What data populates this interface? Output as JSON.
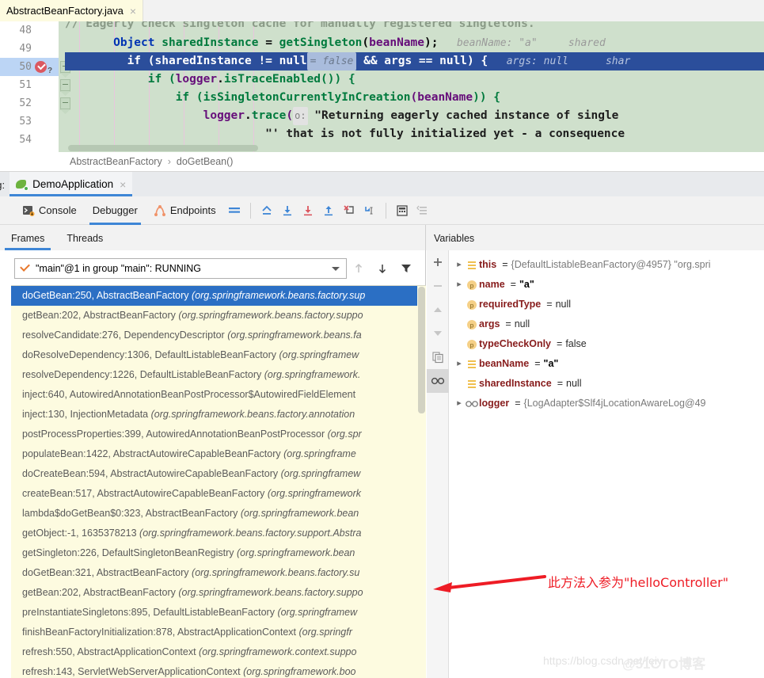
{
  "editor": {
    "tab": {
      "filename": "AbstractBeanFactory.java",
      "close": "×"
    },
    "line_numbers": [
      "48",
      "49",
      "50",
      "51",
      "52",
      "53",
      "54"
    ],
    "lines": [
      {
        "n": "48",
        "text": "// Eagerly check singleton cache for manually registered singletons."
      },
      {
        "n": "49",
        "text": "Object sharedInstance = getSingleton(beanName);",
        "hint": "beanName: \"a\"    shared"
      },
      {
        "n": "50",
        "text": "if (sharedInstance != null = false && args == null) {",
        "hint": "args: null      shar"
      },
      {
        "n": "51",
        "text": "if (logger.isTraceEnabled()) {"
      },
      {
        "n": "52",
        "text": "if (isSingletonCurrentlyInCreation(beanName)) {"
      },
      {
        "n": "53",
        "text": "logger.trace( o: \"Returning eagerly cached instance of single"
      },
      {
        "n": "54",
        "text": "\"' that is not fully initialized yet - a consequence"
      }
    ],
    "tokens": {
      "comment48": "// Eagerly check singleton cache for manually registered singletons.",
      "l49_type": "Object",
      "l49_var": " sharedInstance ",
      "l49_eq": "= ",
      "l49_call": "getSingleton",
      "l49_open": "(",
      "l49_arg": "beanName",
      "l49_close": ");",
      "l49_hint1": "beanName: \"a\"",
      "l49_hint2": "shared",
      "l50_if": "if (sharedInstance != null",
      "l50_badge": "= false",
      "l50_rest": " && args == null) {",
      "l50_hint1": "args: null",
      "l50_hint2": "shar",
      "l51_if": "if (",
      "l51_obj": "logger",
      "l51_dot": ".",
      "l51_m": "isTraceEnabled",
      "l51_end": "()) {",
      "l52_if": "if (",
      "l52_m": "isSingletonCurrentlyInCreation",
      "l52_open": "(",
      "l52_arg": "beanName",
      "l52_end": ")) {",
      "l53_obj": "logger",
      "l53_dot": ".",
      "l53_m": "trace",
      "l53_open": "(",
      "l53_param": "o:",
      "l53_str": " \"Returning eagerly cached instance of single",
      "l54_str": "\"' that is not fully initialized yet - a consequence"
    },
    "breadcrumb": {
      "class": "AbstractBeanFactory",
      "separator": "›",
      "method": "doGetBean()"
    }
  },
  "debug_window": {
    "title": "ug:",
    "run_tab": {
      "label": "DemoApplication",
      "icon": "spring-boot-icon",
      "close": "×"
    },
    "toolbar_tabs": [
      {
        "label": "Console",
        "icon": "console-icon",
        "active": false
      },
      {
        "label": "Debugger",
        "icon": "",
        "active": true
      },
      {
        "label": "Endpoints",
        "icon": "endpoints-icon",
        "active": false
      }
    ],
    "toolbar_buttons": [
      {
        "name": "show-execution-point-icon",
        "title": "Show Execution Point"
      },
      {
        "name": "step-over-icon",
        "title": "Step Over"
      },
      {
        "name": "step-into-icon",
        "title": "Step Into"
      },
      {
        "name": "force-step-into-icon",
        "title": "Force Step Into"
      },
      {
        "name": "step-out-icon",
        "title": "Step Out"
      },
      {
        "name": "drop-frame-icon",
        "title": "Drop Frame"
      },
      {
        "name": "run-to-cursor-icon",
        "title": "Run to Cursor"
      },
      {
        "name": "evaluate-expression-icon",
        "title": "Evaluate Expression"
      },
      {
        "name": "settings-lines-icon",
        "title": "Layout Settings"
      }
    ]
  },
  "frames": {
    "tabs": [
      {
        "label": "Frames",
        "active": true
      },
      {
        "label": "Threads",
        "active": false
      }
    ],
    "thread_selector": "\"main\"@1 in group \"main\": RUNNING",
    "items": [
      {
        "method": "doGetBean:250, AbstractBeanFactory ",
        "pkg": "(org.springframework.beans.factory.sup",
        "selected": true
      },
      {
        "method": "getBean:202, AbstractBeanFactory ",
        "pkg": "(org.springframework.beans.factory.suppo",
        "selected": false
      },
      {
        "method": "resolveCandidate:276, DependencyDescriptor ",
        "pkg": "(org.springframework.beans.fa",
        "selected": false
      },
      {
        "method": "doResolveDependency:1306, DefaultListableBeanFactory ",
        "pkg": "(org.springframew",
        "selected": false
      },
      {
        "method": "resolveDependency:1226, DefaultListableBeanFactory ",
        "pkg": "(org.springframework.",
        "selected": false
      },
      {
        "method": "inject:640, AutowiredAnnotationBeanPostProcessor$AutowiredFieldElement",
        "pkg": "",
        "selected": false
      },
      {
        "method": "inject:130, InjectionMetadata ",
        "pkg": "(org.springframework.beans.factory.annotation",
        "selected": false
      },
      {
        "method": "postProcessProperties:399, AutowiredAnnotationBeanPostProcessor ",
        "pkg": "(org.spr",
        "selected": false
      },
      {
        "method": "populateBean:1422, AbstractAutowireCapableBeanFactory ",
        "pkg": "(org.springframe",
        "selected": false
      },
      {
        "method": "doCreateBean:594, AbstractAutowireCapableBeanFactory ",
        "pkg": "(org.springframew",
        "selected": false
      },
      {
        "method": "createBean:517, AbstractAutowireCapableBeanFactory ",
        "pkg": "(org.springframework",
        "selected": false
      },
      {
        "method": "lambda$doGetBean$0:323, AbstractBeanFactory ",
        "pkg": "(org.springframework.bean",
        "selected": false
      },
      {
        "method": "getObject:-1, 1635378213 ",
        "pkg": "(org.springframework.beans.factory.support.Abstra",
        "selected": false
      },
      {
        "method": "getSingleton:226, DefaultSingletonBeanRegistry ",
        "pkg": "(org.springframework.bean",
        "selected": false
      },
      {
        "method": "doGetBean:321, AbstractBeanFactory ",
        "pkg": "(org.springframework.beans.factory.su",
        "selected": false
      },
      {
        "method": "getBean:202, AbstractBeanFactory ",
        "pkg": "(org.springframework.beans.factory.suppo",
        "selected": false
      },
      {
        "method": "preInstantiateSingletons:895, DefaultListableBeanFactory ",
        "pkg": "(org.springframew",
        "selected": false
      },
      {
        "method": "finishBeanFactoryInitialization:878, AbstractApplicationContext ",
        "pkg": "(org.springfr",
        "selected": false
      },
      {
        "method": "refresh:550, AbstractApplicationContext ",
        "pkg": "(org.springframework.context.suppo",
        "selected": false
      },
      {
        "method": "refresh:143, ServletWebServerApplicationContext ",
        "pkg": "(org.springframework.boo",
        "selected": false
      }
    ]
  },
  "variables": {
    "tab": "Variables",
    "side_buttons": [
      {
        "name": "add-watch-button",
        "glyph": "+"
      },
      {
        "name": "remove-watch-button",
        "glyph": "−"
      },
      {
        "name": "move-up-button",
        "glyph": "▲"
      },
      {
        "name": "move-down-button",
        "glyph": "▼"
      },
      {
        "name": "copy-value-button",
        "glyph": "❐"
      },
      {
        "name": "watches-button",
        "glyph": "∞"
      }
    ],
    "items": [
      {
        "expandable": true,
        "icon": "field-icon",
        "name": "this",
        "value": "{DefaultListableBeanFactory@4957} \"org.spri",
        "kind": "ref"
      },
      {
        "expandable": true,
        "icon": "param-icon",
        "name": "name",
        "value": "\"a\"",
        "kind": "str"
      },
      {
        "expandable": false,
        "icon": "param-icon",
        "name": "requiredType",
        "value": "null",
        "kind": "plain"
      },
      {
        "expandable": false,
        "icon": "param-icon",
        "name": "args",
        "value": "null",
        "kind": "plain"
      },
      {
        "expandable": false,
        "icon": "param-icon",
        "name": "typeCheckOnly",
        "value": "false",
        "kind": "plain"
      },
      {
        "expandable": true,
        "icon": "field-icon",
        "name": "beanName",
        "value": "\"a\"",
        "kind": "str"
      },
      {
        "expandable": false,
        "icon": "field-icon",
        "name": "sharedInstance",
        "value": "null",
        "kind": "plain"
      },
      {
        "expandable": true,
        "icon": "watch-icon",
        "name": "logger",
        "value": "{LogAdapter$Slf4jLocationAwareLog@49",
        "kind": "ref"
      }
    ]
  },
  "annotation": {
    "text": "此方法入参为\"helloController\"",
    "color": "#ee1c25"
  },
  "watermark": {
    "url": "https://blog.csdn.net/feiy",
    "brand": "@51CTO博客"
  },
  "colors": {
    "accent_blue": "#3e86d6",
    "selection_blue": "#2b6fc4",
    "code_line_highlight": "#2b4e9b",
    "editor_bg": "#cfe0cc",
    "frames_bg": "#fdfbe0",
    "annotation_red": "#ee1c25"
  }
}
